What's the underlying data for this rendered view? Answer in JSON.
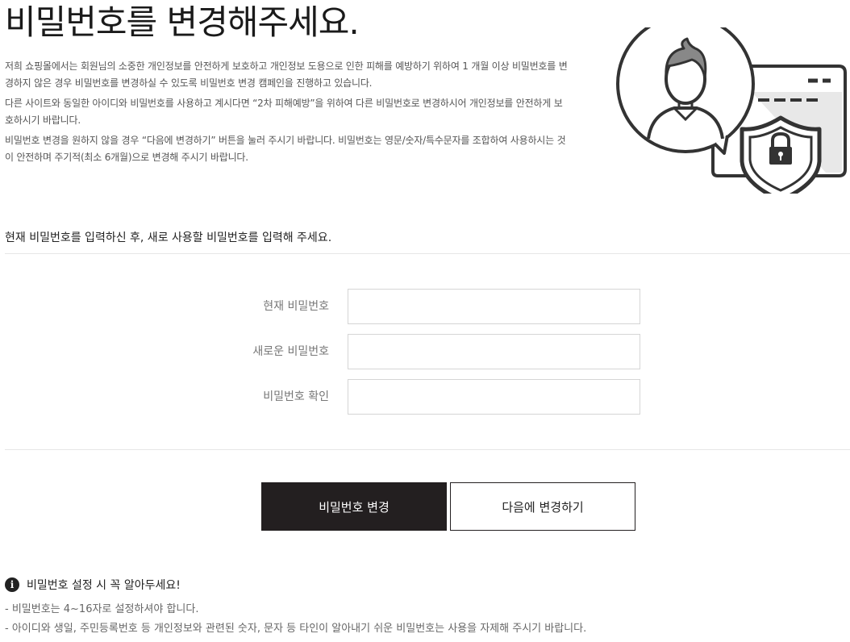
{
  "header": {
    "title": "비밀번호를 변경해주세요."
  },
  "intro": {
    "paragraphs": [
      "저희 쇼핑몰에서는 회원님의 소중한 개인정보를 안전하게 보호하고 개인정보 도용으로 인한 피해를 예방하기 위하여 1 개월 이상 비밀번호를 변경하지 않은 경우 비밀번호를 변경하실 수 있도록 비밀번호 변경 캠페인을 진행하고 있습니다.",
      "다른 사이트와 동일한 아이디와 비밀번호를 사용하고 계시다면 “2차 피해예방”을 위하여 다른 비밀번호로 변경하시어 개인정보를 안전하게 보호하시기 바랍니다.",
      "비밀번호 변경을 원하지 않을 경우 “다음에 변경하기” 버튼을 눌러 주시기 바랍니다. 비밀번호는 영문/숫자/특수문자를 조합하여 사용하시는 것이 안전하며 주기적(최소 6개월)으로 변경해 주시기 바랍니다."
    ]
  },
  "illustration": {
    "icon": "user-security-shield-lock-icon"
  },
  "form": {
    "instruction": "현재 비밀번호를 입력하신 후, 새로 사용할 비밀번호를 입력해 주세요.",
    "current_password_label": "현재 비밀번호",
    "new_password_label": "새로운 비밀번호",
    "confirm_password_label": "비밀번호 확인",
    "current_password_value": "",
    "new_password_value": "",
    "confirm_password_value": ""
  },
  "buttons": {
    "change_label": "비밀번호 변경",
    "later_label": "다음에 변경하기"
  },
  "notice": {
    "icon_glyph": "i",
    "title": "비밀번호 설정 시 꼭 알아두세요!",
    "items": [
      "- 비밀번호는 4~16자로 설정하셔야 합니다.",
      "- 아이디와 생일, 주민등록번호 등 개인정보와 관련된 숫자, 문자 등 타인이 알아내기 쉬운 비밀번호는 사용을 자제해 주시기 바랍니다."
    ]
  },
  "colors": {
    "primary_button_bg": "#231f20",
    "divider": "#e6e6e6",
    "input_border": "#d5d5d5"
  }
}
